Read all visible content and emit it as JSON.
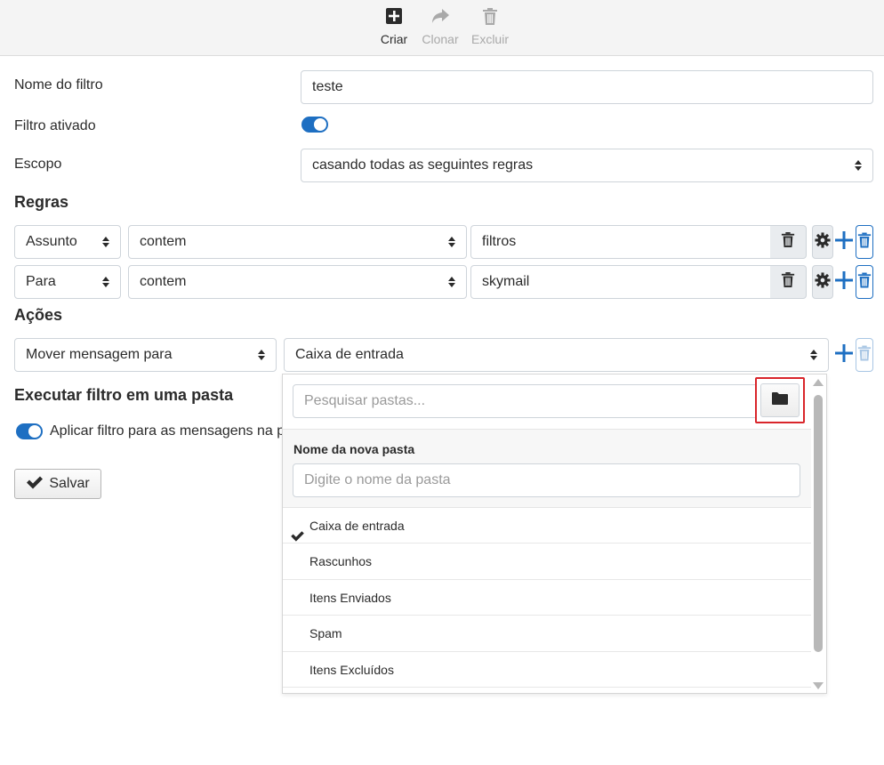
{
  "toolbar": {
    "create_label": "Criar",
    "clone_label": "Clonar",
    "delete_label": "Excluir"
  },
  "form": {
    "name_label": "Nome do filtro",
    "name_value": "teste",
    "enabled_label": "Filtro ativado",
    "enabled": true,
    "scope_label": "Escopo",
    "scope_value": "casando todas as seguintes regras"
  },
  "rules": {
    "heading": "Regras",
    "items": [
      {
        "header": "Assunto",
        "op": "contem",
        "value": "filtros"
      },
      {
        "header": "Para",
        "op": "contem",
        "value": "skymail"
      }
    ]
  },
  "actions": {
    "heading": "Ações",
    "action_value": "Mover mensagem para",
    "target_value": "Caixa de entrada"
  },
  "run": {
    "heading": "Executar filtro em uma pasta",
    "apply_label": "Aplicar filtro para as mensagens na pa",
    "apply_enabled": true
  },
  "save_label": "Salvar",
  "popup": {
    "search_placeholder": "Pesquisar pastas...",
    "new_folder_label": "Nome da nova pasta",
    "new_folder_placeholder": "Digite o nome da pasta",
    "folders": [
      {
        "name": "Caixa de entrada",
        "selected": true
      },
      {
        "name": "Rascunhos",
        "selected": false
      },
      {
        "name": "Itens Enviados",
        "selected": false
      },
      {
        "name": "Spam",
        "selected": false
      },
      {
        "name": "Itens Excluídos",
        "selected": false
      }
    ]
  },
  "colors": {
    "accent": "#1e6fc2",
    "highlight": "#d9262b"
  }
}
